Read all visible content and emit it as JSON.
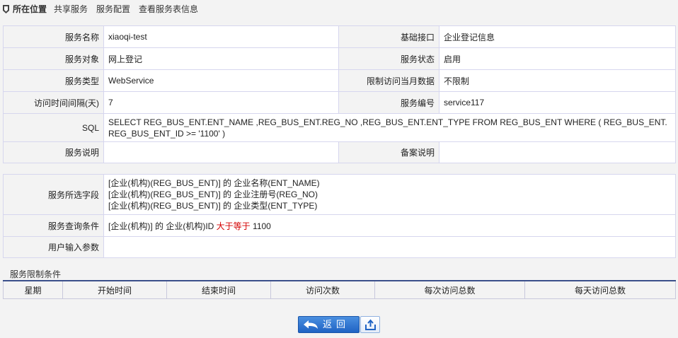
{
  "breadcrumb": {
    "title": "所在位置",
    "items": [
      "共享服务",
      "服务配置",
      "查看服务表信息"
    ]
  },
  "service": {
    "name_label": "服务名称",
    "name": "xiaoqi-test",
    "interface_label": "基础接口",
    "interface": "企业登记信息",
    "target_label": "服务对象",
    "target": "网上登记",
    "status_label": "服务状态",
    "status": "启用",
    "type_label": "服务类型",
    "type": "WebService",
    "limit_month_label": "限制访问当月数据",
    "limit_month": "不限制",
    "interval_label": "访问时间间隔(天)",
    "interval": "7",
    "code_label": "服务编号",
    "code": "service117",
    "sql_label": "SQL",
    "sql": "SELECT REG_BUS_ENT.ENT_NAME ,REG_BUS_ENT.REG_NO ,REG_BUS_ENT.ENT_TYPE FROM REG_BUS_ENT WHERE ( REG_BUS_ENT.REG_BUS_ENT_ID >= '1100' )",
    "desc_label": "服务说明",
    "desc": "",
    "record_label": "备案说明",
    "record": ""
  },
  "query": {
    "fields_label": "服务所选字段",
    "fields": [
      "[企业(机构)(REG_BUS_ENT)] 的  企业名称(ENT_NAME)",
      "[企业(机构)(REG_BUS_ENT)] 的  企业注册号(REG_NO)",
      "[企业(机构)(REG_BUS_ENT)] 的  企业类型(ENT_TYPE)"
    ],
    "condition_label": "服务查询条件",
    "condition_prefix": "[企业(机构)] 的  企业(机构)ID",
    "condition_op": "大于等于",
    "condition_value": "1100",
    "input_label": "用户输入参数",
    "input": ""
  },
  "limits": {
    "title": "服务限制条件",
    "columns": [
      "星期",
      "开始时间",
      "结束时间",
      "访问次数",
      "每次访问总数",
      "每天访问总数"
    ]
  },
  "buttons": {
    "back": "返回"
  },
  "colors": {
    "accent": "#2a6fcf",
    "operator": "#d40000",
    "border": "#d6d6ee"
  }
}
